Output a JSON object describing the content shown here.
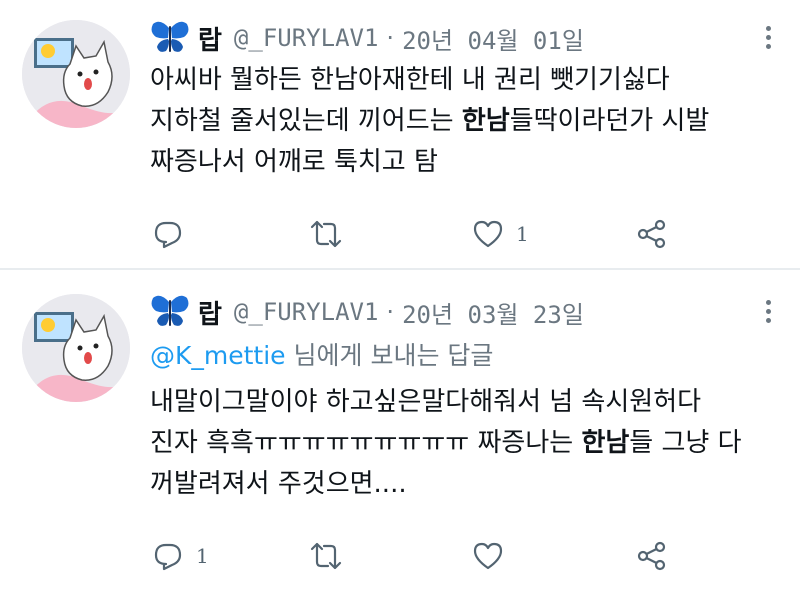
{
  "tweets": [
    {
      "display_name": "랍",
      "handle": "@_FURYLAV1",
      "date": "20년 04월 01일",
      "reply_to": null,
      "lines": [
        {
          "a": "아씨바 뭘하든 한남아재한테 내 권리 뺏기기싫다",
          "kw": "",
          "b": ""
        },
        {
          "a": "지하철 줄서있는데 끼어드는 ",
          "kw": "한남",
          "b": "들딱이라던가 시발"
        },
        {
          "a": "짜증나서 어깨로 툭치고 탐",
          "kw": "",
          "b": ""
        }
      ],
      "reply_count": "",
      "like_count": "1"
    },
    {
      "display_name": "랍",
      "handle": "@_FURYLAV1",
      "date": "20년 03월 23일",
      "reply_to": {
        "mention": "@K_mettie",
        "suffix": " 님에게 보내는 답글"
      },
      "lines": [
        {
          "a": "내말이그말이야 하고싶은말다해줘서 넘 속시원허다",
          "kw": "",
          "b": ""
        },
        {
          "a": "진자 흑흑ㅠㅠㅠㅠㅠㅠㅠㅠㅠ 짜증나는 ",
          "kw": "한남",
          "b": "들 그냥 다"
        },
        {
          "a": "꺼발려져서 주것으면....",
          "kw": "",
          "b": ""
        }
      ],
      "reply_count": "1",
      "like_count": ""
    }
  ],
  "icons": {
    "emoji": "butterfly-icon",
    "more": "more-icon",
    "reply": "reply-icon",
    "retweet": "retweet-icon",
    "like": "heart-icon",
    "share": "share-icon"
  },
  "colors": {
    "mention": "#1d9bf0",
    "secondary_text": "#6b7781",
    "butterfly": "#1f6fd6",
    "divider": "#e8ecef"
  }
}
